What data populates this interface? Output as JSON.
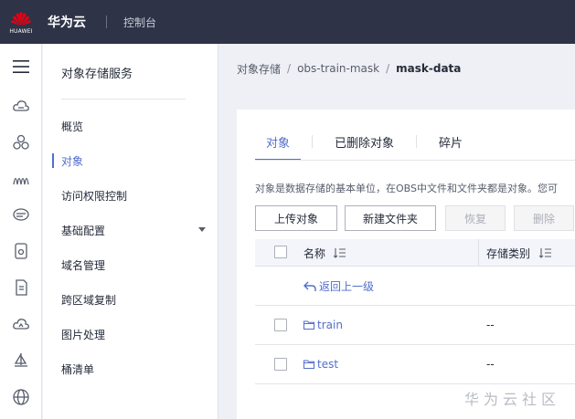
{
  "topbar": {
    "logo_text": "HUAWEI",
    "brand": "华为云",
    "console": "控制台"
  },
  "rail": {
    "items": [
      "menu-icon",
      "cloud-icon",
      "network-icon",
      "waves-icon",
      "chat-icon",
      "storage-icon",
      "file-icon",
      "cloud-alt-icon",
      "sailboat-icon",
      "globe-icon"
    ]
  },
  "sidebar": {
    "title": "对象存储服务",
    "items": [
      {
        "label": "概览"
      },
      {
        "label": "对象"
      },
      {
        "label": "访问权限控制"
      },
      {
        "label": "基础配置"
      },
      {
        "label": "域名管理"
      },
      {
        "label": "跨区域复制"
      },
      {
        "label": "图片处理"
      },
      {
        "label": "桶清单"
      }
    ],
    "active_index": 1
  },
  "breadcrumb": {
    "items": [
      "对象存储",
      "obs-train-mask",
      "mask-data"
    ],
    "separator": "/"
  },
  "tabs": [
    {
      "label": "对象"
    },
    {
      "label": "已删除对象"
    },
    {
      "label": "碎片"
    }
  ],
  "description": "对象是数据存储的基本单位，在OBS中文件和文件夹都是对象。您可",
  "toolbar": {
    "upload": "上传对象",
    "new_folder": "新建文件夹",
    "restore": "恢复",
    "delete": "删除"
  },
  "table": {
    "columns": {
      "name": "名称",
      "storage_class": "存储类别"
    },
    "back_label": "返回上一级",
    "rows": [
      {
        "name": "train",
        "storage_class": "--"
      },
      {
        "name": "test",
        "storage_class": "--"
      }
    ]
  },
  "watermark": "华为云社区",
  "colors": {
    "topbar": "#2e3347",
    "accent": "#526ecc",
    "logo_red": "#e60012"
  }
}
